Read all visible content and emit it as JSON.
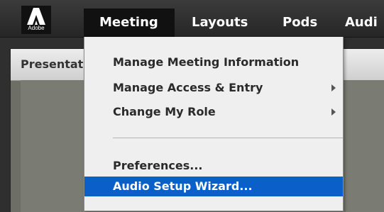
{
  "logo": {
    "wordmark": "Adobe"
  },
  "menubar": {
    "items": [
      {
        "label": "Meeting"
      },
      {
        "label": "Layouts"
      },
      {
        "label": "Pods"
      },
      {
        "label": "Audi"
      }
    ]
  },
  "pod": {
    "title": "Presentat"
  },
  "meeting_menu": {
    "items": [
      {
        "label": "Manage Meeting Information",
        "submenu": false
      },
      {
        "label": "Manage Access & Entry",
        "submenu": true
      },
      {
        "label": "Change My Role",
        "submenu": true
      },
      {
        "label": "Preferences...",
        "submenu": false
      },
      {
        "label": "Audio Setup Wizard...",
        "submenu": false,
        "highlighted": true
      }
    ]
  },
  "colors": {
    "highlight": "#0a5fc8",
    "menubar": "#2f2f2f",
    "menu_bg": "#efefef"
  },
  "icons": {
    "submenu_arrow": "arrow-right-icon"
  }
}
